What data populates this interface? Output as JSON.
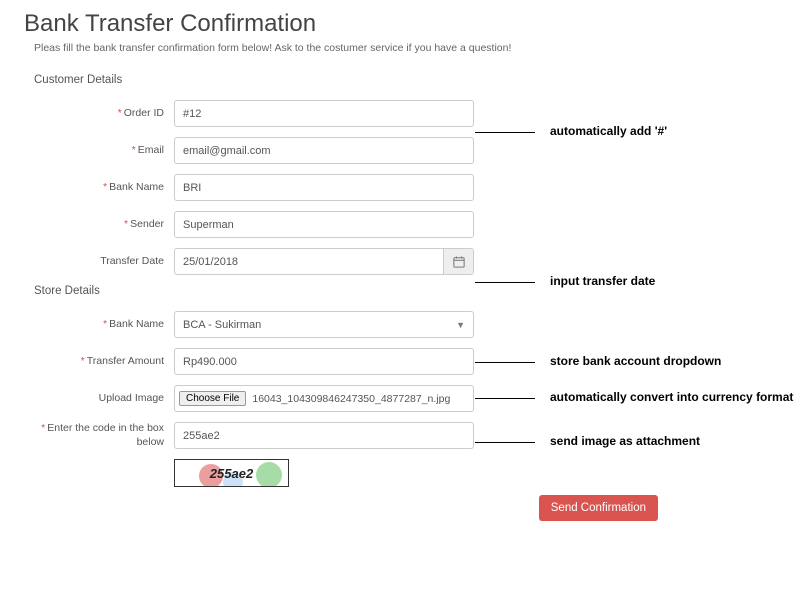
{
  "page_title": "Bank Transfer Confirmation",
  "subtitle": "Pleas fill the bank transfer confirmation form below! Ask to the costumer service if you have a question!",
  "sections": {
    "customer": "Customer Details",
    "store": "Store Details"
  },
  "fields": {
    "order_id": {
      "label": "Order ID",
      "value": "#12",
      "required": true
    },
    "email": {
      "label": "Email",
      "value": "email@gmail.com",
      "required": true
    },
    "bank_name": {
      "label": "Bank Name",
      "value": "BRI",
      "required": true
    },
    "sender": {
      "label": "Sender",
      "value": "Superman",
      "required": true
    },
    "transfer_date": {
      "label": "Transfer Date",
      "value": "25/01/2018",
      "required": false
    },
    "store_bank": {
      "label": "Bank Name",
      "value": "BCA - Sukirman",
      "required": true
    },
    "transfer_amount": {
      "label": "Transfer Amount",
      "value": "Rp490.000",
      "required": true
    },
    "upload_image": {
      "label": "Upload Image",
      "button": "Choose File",
      "filename": "16043_104309846247350_4877287_n.jpg",
      "required": false
    },
    "captcha": {
      "label": "Enter the code in the box below",
      "value": "255ae2",
      "image_text": "255ae2",
      "required": true
    }
  },
  "submit_label": "Send Confirmation",
  "annotations": {
    "order_id": "automatically add '#'",
    "transfer_date": "input transfer date",
    "store_bank": "store bank account dropdown",
    "transfer_amount": "automatically convert into currency format",
    "upload_image": "send image as attachment"
  }
}
